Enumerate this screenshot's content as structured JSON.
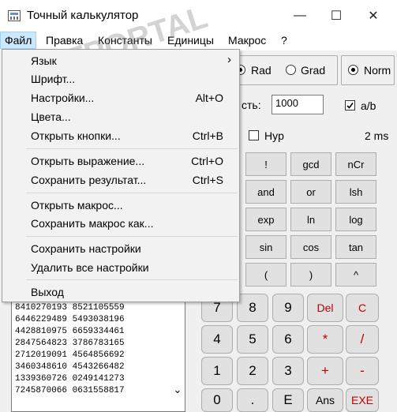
{
  "window": {
    "title": "Точный калькулятор",
    "minimize_glyph": "—",
    "maximize_glyph": "☐",
    "close_glyph": "✕"
  },
  "menubar": {
    "file": "Файл",
    "edit": "Правка",
    "constants": "Константы",
    "units": "Единицы",
    "macro": "Макрос",
    "help": "?"
  },
  "file_menu": {
    "language": {
      "label": "Язык",
      "submenu_glyph": "›"
    },
    "font": {
      "label": "Шрифт..."
    },
    "settings": {
      "label": "Настройки...",
      "shortcut": "Alt+O"
    },
    "colors": {
      "label": "Цвета..."
    },
    "open_buttons": {
      "label": "Открыть кнопки...",
      "shortcut": "Ctrl+B"
    },
    "open_expression": {
      "label": "Открыть выражение...",
      "shortcut": "Ctrl+O"
    },
    "save_result": {
      "label": "Сохранить результат...",
      "shortcut": "Ctrl+S"
    },
    "open_macro": {
      "label": "Открыть макрос..."
    },
    "save_macro_as": {
      "label": "Сохранить макрос как..."
    },
    "save_settings": {
      "label": "Сохранить настройки"
    },
    "delete_all_settings": {
      "label": "Удалить все настройки"
    },
    "exit": {
      "label": "Выход"
    }
  },
  "angle_units": {
    "rad": "Rad",
    "grad": "Grad",
    "selected": "Rad"
  },
  "format": {
    "norm": "Norm",
    "norm_selected": true
  },
  "precision": {
    "label_partial": "сть:",
    "value": "1000"
  },
  "fraction": {
    "label": "a/b",
    "checked": true
  },
  "hyp": {
    "label": "Hyp",
    "checked": false
  },
  "timing": "2 ms",
  "func_buttons": [
    [
      "!",
      "gcd",
      "nCr"
    ],
    [
      "and",
      "ln",
      "lsh"
    ],
    [
      "exp",
      "ln",
      "log"
    ],
    [
      "sin",
      "cos",
      "tan"
    ],
    [
      "(",
      ")",
      "^"
    ]
  ],
  "keypad": [
    [
      "7",
      "8",
      "9",
      "Del",
      "C"
    ],
    [
      "4",
      "5",
      "6",
      "*",
      "/"
    ],
    [
      "1",
      "2",
      "3",
      "+",
      "-"
    ],
    [
      "0",
      ".",
      "E",
      "Ans",
      "EXE"
    ]
  ],
  "results_lines": [
    "8410270193 8521105559",
    "6446229489 5493038196",
    "4428810975 6659334461",
    "2847564823 3786783165",
    "2712019091 4564856692",
    "3460348610 4543266482",
    "1339360726 0249141273",
    "7245870066 0631558817"
  ],
  "results_scroll_glyph": "⌄",
  "watermark": "SOFTPORTAL",
  "colors": {
    "accent_text": "#c00000",
    "menu_highlight": "#cce8ff",
    "exe_text": "#c00000"
  }
}
